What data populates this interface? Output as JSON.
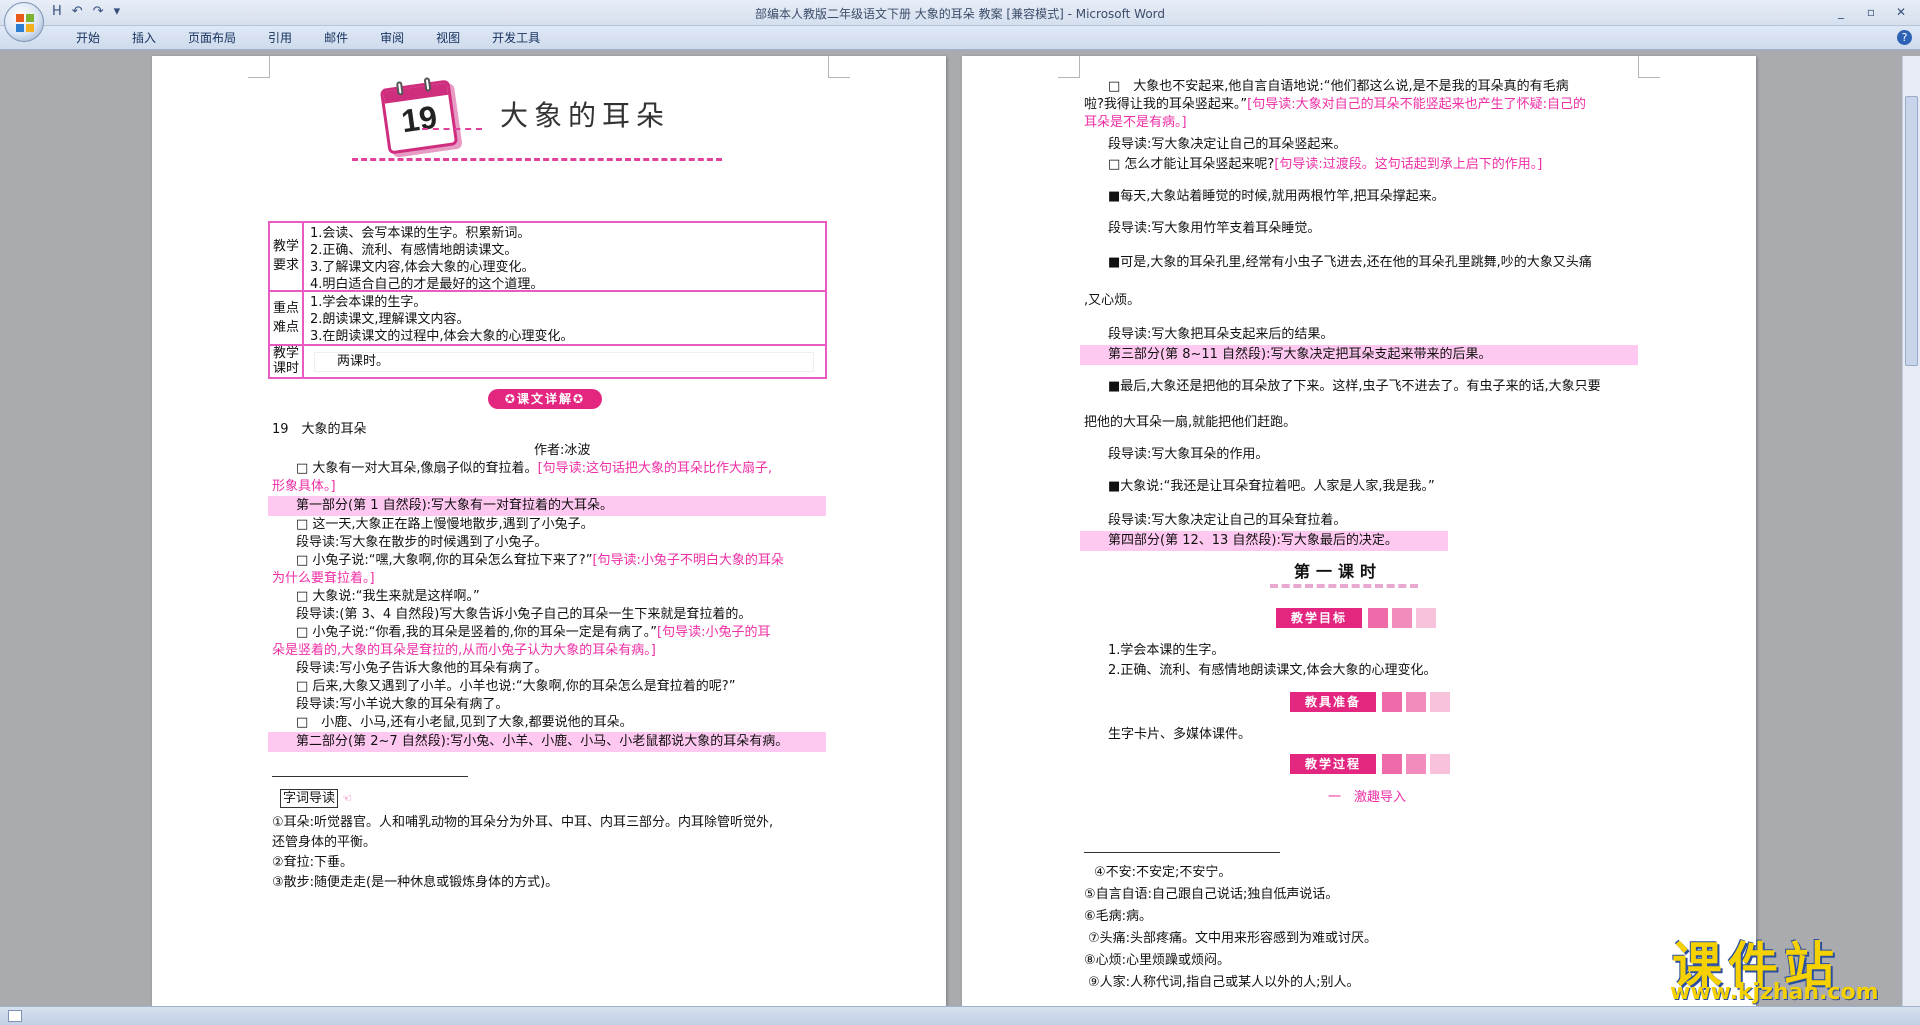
{
  "window": {
    "title": "部编本人教版二年级语文下册 大象的耳朵 教案 [兼容模式] - Microsoft Word",
    "qat": [
      "H",
      "↶",
      "↷",
      "▾"
    ],
    "controls": [
      "_",
      "▫",
      "✕"
    ]
  },
  "ribbon": {
    "tabs": [
      "开始",
      "插入",
      "页面布局",
      "引用",
      "邮件",
      "审阅",
      "视图",
      "开发工具"
    ],
    "help": "?"
  },
  "left_page": {
    "lesson_number": "19",
    "lesson_title": "大象的耳朵",
    "table": {
      "rows": [
        {
          "header": [
            "教学",
            "要求"
          ],
          "items": [
            "1.会读、会写本课的生字。积累新词。",
            "2.正确、流利、有感情地朗读课文。",
            "3.了解课文内容,体会大象的心理变化。",
            "4.明白适合自己的才是最好的这个道理。"
          ]
        },
        {
          "header": [
            "重点",
            "难点"
          ],
          "items": [
            "1.学会本课的生字。",
            "2.朗读课文,理解课文内容。",
            "3.在朗读课文的过程中,体会大象的心理变化。"
          ]
        },
        {
          "header": [
            "教学",
            "课时"
          ],
          "items": [
            "两课时。"
          ]
        }
      ]
    },
    "section_badge": "课文详解",
    "lines": [
      {
        "text": "19　大象的耳朵",
        "type": "normal"
      },
      {
        "text": "作者:冰波",
        "type": "center"
      },
      {
        "text": "□ 大象有一对大耳朵,像扇子似的耷拉着。",
        "guide": "[句导读:这句话把大象的耳朵比作大扇子,",
        "type": "mixed"
      },
      {
        "text": "形象具体。]",
        "type": "guide"
      },
      {
        "text": "第一部分(第 1 自然段):写大象有一对耷拉着的大耳朵。",
        "type": "highlight"
      },
      {
        "text": "□ 这一天,大象正在路上慢慢地散步,遇到了小兔子。",
        "type": "indent"
      },
      {
        "text": "段导读:写大象在散步的时候遇到了小兔子。",
        "type": "indent"
      },
      {
        "text": "□ 小兔子说:“嘿,大象啊,你的耳朵怎么耷拉下来了?”",
        "guide": "[句导读:小兔子不明白大象的耳朵",
        "type": "mixed"
      },
      {
        "text": "为什么要耷拉着。]",
        "type": "guide"
      },
      {
        "text": "□ 大象说:“我生来就是这样啊。”",
        "type": "indent"
      },
      {
        "text": "段导读:(第 3、4 自然段)写大象告诉小兔子自己的耳朵一生下来就是耷拉着的。",
        "type": "indent"
      },
      {
        "text": "□ 小兔子说:“你看,我的耳朵是竖着的,你的耳朵一定是有病了。”",
        "guide": "[句导读:小兔子的耳",
        "type": "mixed"
      },
      {
        "text": "朵是竖着的,大象的耳朵是耷拉的,从而小兔子认为大象的耳朵有病。]",
        "type": "guide"
      },
      {
        "text": "段导读:写小兔子告诉大象他的耳朵有病了。",
        "type": "indent"
      },
      {
        "text": "□ 后来,大象又遇到了小羊。小羊也说:“大象啊,你的耳朵怎么是耷拉着的呢?”",
        "type": "indent"
      },
      {
        "text": "段导读:写小羊说大象的耳朵有病了。",
        "type": "indent"
      },
      {
        "text": "□　小鹿、小马,还有小老鼠,见到了大象,都要说他的耳朵。",
        "type": "indent"
      },
      {
        "text": "第二部分(第 2~7 自然段):写小兔、小羊、小鹿、小马、小老鼠都说大象的耳朵有病。",
        "type": "highlight"
      }
    ],
    "footnotes": [
      {
        "label": "字词导读",
        "text": ""
      },
      {
        "text": "①耳朵:听觉器官。人和哺乳动物的耳朵分为外耳、中耳、内耳三部分。内耳除管听觉外,"
      },
      {
        "text": "还管身体的平衡。"
      },
      {
        "text": "②耷拉:下垂。"
      },
      {
        "text": "③散步:随便走走(是一种休息或锻炼身体的方式)。"
      }
    ]
  },
  "right_page": {
    "lines": [
      {
        "text": "□　大象也不安起来,他自言自语地说:“他们都这么说,是不是我的耳朵真的有毛病",
        "type": "indent"
      },
      {
        "text": "啦?我得让我的耳朵竖起来。”",
        "guide": "[句导读:大象对自己的耳朵不能竖起来也产生了怀疑:自己的",
        "type": "mixed0"
      },
      {
        "text": "耳朵是不是有病。]",
        "type": "guide0"
      },
      {
        "text": "段导读:写大象决定让自己的耳朵竖起来。",
        "type": "indent"
      },
      {
        "text": "□ 怎么才能让耳朵竖起来呢?",
        "guide": "[句导读:过渡段。这句话起到承上启下的作用。]",
        "type": "mixed"
      },
      {
        "text": "■每天,大象站着睡觉的时候,就用两根竹竿,把耳朵撑起来。",
        "type": "indent"
      },
      {
        "text": "段导读:写大象用竹竿支着耳朵睡觉。",
        "type": "indent"
      },
      {
        "text": "■可是,大象的耳朵孔里,经常有小虫子飞进去,还在他的耳朵孔里跳舞,吵的大象又头痛",
        "type": "indent"
      },
      {
        "text": ",又心烦。",
        "type": "normal0"
      },
      {
        "text": "段导读:写大象把耳朵支起来后的结果。",
        "type": "indent"
      },
      {
        "text": "第三部分(第 8~11 自然段):写大象决定把耳朵支起来带来的后果。",
        "type": "highlight"
      },
      {
        "text": "■最后,大象还是把他的耳朵放了下来。这样,虫子飞不进去了。有虫子来的话,大象只要",
        "type": "indent"
      },
      {
        "text": "把他的大耳朵一扇,就能把他们赶跑。",
        "type": "normal0"
      },
      {
        "text": "段导读:写大象耳朵的作用。",
        "type": "indent"
      },
      {
        "text": "■大象说:“我还是让耳朵耷拉着吧。人家是人家,我是我。”",
        "type": "indent"
      },
      {
        "text": "段导读:写大象决定让自己的耳朵耷拉着。",
        "type": "indent"
      },
      {
        "text": "第四部分(第 12、13 自然段):写大象最后的决定。",
        "type": "highlight"
      }
    ],
    "lesson_period": "第一课时",
    "goal_badge": "教学目标",
    "goals": [
      "1.学会本课的生字。",
      "2.正确、流利、有感情地朗读课文,体会大象的心理变化。"
    ],
    "prep_badge": "教具准备",
    "prep": "生字卡片、多媒体课件。",
    "process_badge": "教学过程",
    "step1": "一　激趣导入",
    "footnotes": [
      "④不安:不安定;不安宁。",
      "⑤自言自语:自己跟自己说话;独自低声说话。",
      "⑥毛病:病。",
      "⑦头痛:头部疼痛。文中用来形容感到为难或讨厌。",
      "⑧心烦:心里烦躁或烦闷。",
      "⑨人家:人称代词,指自己或某人以外的人;别人。"
    ]
  },
  "watermark": {
    "name": "课件站",
    "url": "www.kjzhan.com"
  },
  "colors": {
    "accent": "#ee2fa5",
    "highlight": "#ffc8f0",
    "badge": "#e3267f"
  }
}
